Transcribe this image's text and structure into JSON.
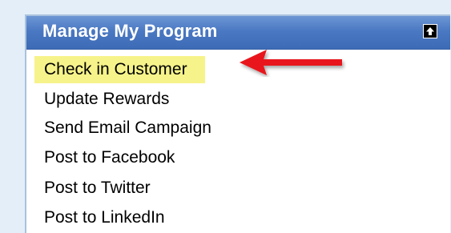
{
  "panel": {
    "title": "Manage My Program",
    "collapse_icon": "arrow-up-box-icon"
  },
  "menu": {
    "items": [
      {
        "label": "Check in Customer",
        "highlighted": true
      },
      {
        "label": "Update Rewards",
        "highlighted": false
      },
      {
        "label": "Send Email Campaign",
        "highlighted": false
      },
      {
        "label": "Post to Facebook",
        "highlighted": false
      },
      {
        "label": "Post to Twitter",
        "highlighted": false
      },
      {
        "label": "Post to LinkedIn",
        "highlighted": false
      }
    ]
  },
  "annotation": {
    "arrow_icon": "red-arrow-icon",
    "arrow_color": "#e8141b",
    "highlight_color": "#f6f38a",
    "header_color": "#4a78c2"
  }
}
